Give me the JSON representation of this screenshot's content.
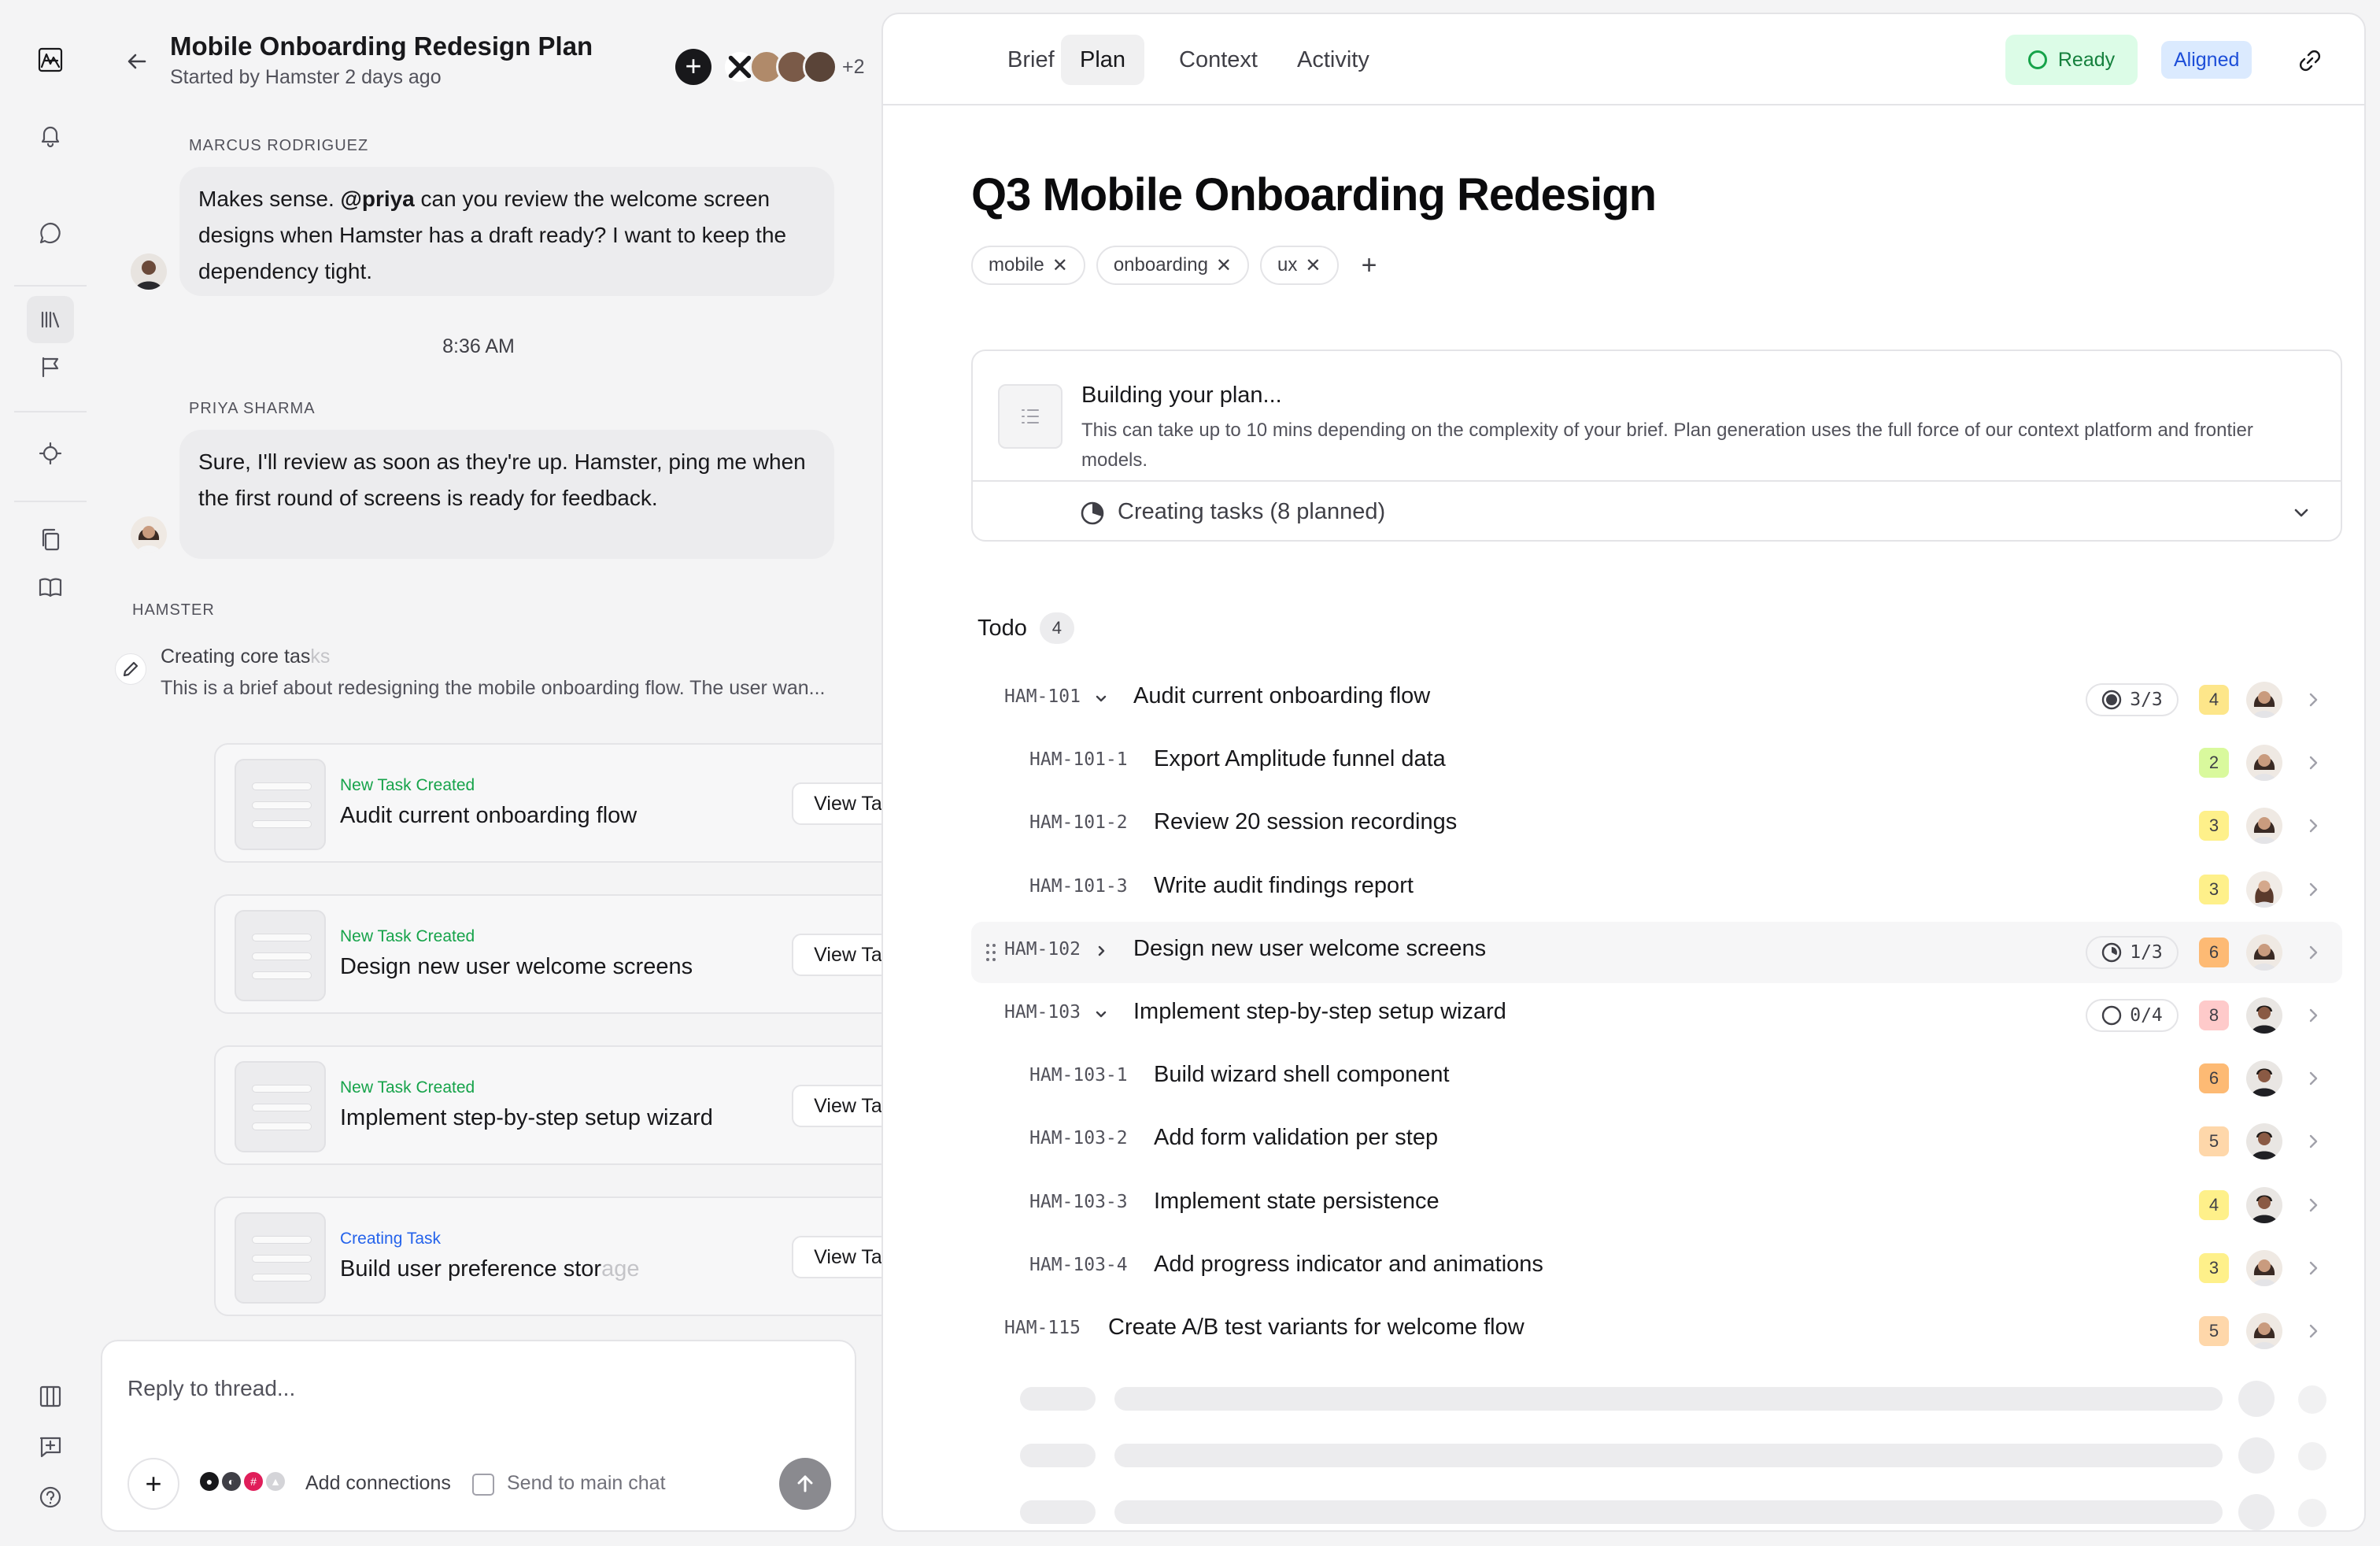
{
  "rail": {
    "items": [
      "logo-icon",
      "bell-icon",
      "chat-icon",
      "library-icon",
      "flag-icon",
      "target-icon",
      "copy-icon",
      "book-icon",
      "columns-icon",
      "feedback-icon",
      "help-icon"
    ]
  },
  "thread": {
    "title": "Mobile Onboarding Redesign Plan",
    "subtitle": "Started by Hamster 2 days ago",
    "participant_extra": "+2",
    "messages": [
      {
        "author": "MARCUS RODRIGUEZ",
        "pre": "Makes sense. ",
        "mention": "@priya",
        "post": " can you review the welcome screen designs when Hamster has a draft ready? I want to keep the dependency tight."
      },
      {
        "author": "PRIYA SHARMA",
        "text": "Sure, I'll review as soon as they're up. Hamster, ping me when the first round of screens is ready for feedback."
      }
    ],
    "time_divider": "8:36 AM",
    "hamster": {
      "author": "HAMSTER",
      "activity_title_a": "Creating core tas",
      "activity_title_b": "ks",
      "activity_desc": "This is a brief about redesigning the mobile onboarding flow. The user wan..."
    },
    "cards": [
      {
        "status": "New Task Created",
        "name_a": "Audit current onboarding flow",
        "name_b": "",
        "button": "View Task"
      },
      {
        "status": "New Task Created",
        "name_a": "Design new user welcome screens",
        "name_b": "",
        "button": "View Task"
      },
      {
        "status": "New Task Created",
        "name_a": "Implement step-by-step setup wizard",
        "name_b": "",
        "button": "View Task"
      },
      {
        "status": "Creating Task",
        "name_a": "Build user preference stor",
        "name_b": "age",
        "button": "View Task"
      }
    ],
    "composer": {
      "placeholder": "Reply to thread...",
      "add_connections": "Add connections",
      "send_to_main": "Send to main chat"
    }
  },
  "main": {
    "tabs": [
      "Brief",
      "Plan",
      "Context",
      "Activity"
    ],
    "active_tab": "Plan",
    "status": "Ready",
    "alignment": "Aligned",
    "title": "Q3 Mobile Onboarding Redesign",
    "tags": [
      "mobile",
      "onboarding",
      "ux"
    ],
    "building": {
      "title": "Building your plan...",
      "desc": "This can take up to 10 mins depending on the complexity of your brief. Plan generation uses the full force of our context platform and frontier models.",
      "progress": "Creating tasks (8 planned)"
    },
    "todo": {
      "label": "Todo",
      "count": "4"
    },
    "tasks": [
      {
        "id": "HAM-101",
        "title": "Audit current onboarding flow",
        "level": 0,
        "caret": "down",
        "progress": "3/3",
        "progress_fraction": 1.0,
        "points": "4",
        "points_color": "#fde68a",
        "avatar": "f"
      },
      {
        "id": "HAM-101-1",
        "title": "Export Amplitude funnel data",
        "level": 1,
        "points": "2",
        "points_color": "#d9f99d",
        "avatar": "f"
      },
      {
        "id": "HAM-101-2",
        "title": "Review 20 session recordings",
        "level": 1,
        "points": "3",
        "points_color": "#fef08a",
        "avatar": "f"
      },
      {
        "id": "HAM-101-3",
        "title": "Write audit findings report",
        "level": 1,
        "points": "3",
        "points_color": "#fef08a",
        "avatar": "f2"
      },
      {
        "id": "HAM-102",
        "title": "Design new user welcome screens",
        "level": 0,
        "caret": "right",
        "progress": "1/3",
        "progress_fraction": 0.33,
        "points": "6",
        "points_color": "#fdba74",
        "avatar": "f",
        "highlight": true
      },
      {
        "id": "HAM-103",
        "title": "Implement step-by-step setup wizard",
        "level": 0,
        "caret": "down",
        "progress": "0/4",
        "progress_fraction": 0,
        "points": "8",
        "points_color": "#fecaca",
        "avatar": "m"
      },
      {
        "id": "HAM-103-1",
        "title": "Build wizard shell component",
        "level": 1,
        "points": "6",
        "points_color": "#fdba74",
        "avatar": "m"
      },
      {
        "id": "HAM-103-2",
        "title": "Add form validation per step",
        "level": 1,
        "points": "5",
        "points_color": "#fed7aa",
        "avatar": "m"
      },
      {
        "id": "HAM-103-3",
        "title": "Implement state persistence",
        "level": 1,
        "points": "4",
        "points_color": "#fef08a",
        "avatar": "m"
      },
      {
        "id": "HAM-103-4",
        "title": "Add progress indicator and animations",
        "level": 1,
        "points": "3",
        "points_color": "#fef08a",
        "avatar": "f"
      },
      {
        "id": "HAM-115",
        "title": "Create A/B test variants for welcome flow",
        "level": 0,
        "points": "5",
        "points_color": "#fed7aa",
        "avatar": "f",
        "no_caret": true
      }
    ]
  },
  "colors": {
    "accent_green": "#16a34a",
    "accent_blue": "#2563eb",
    "text": "#18181b"
  }
}
